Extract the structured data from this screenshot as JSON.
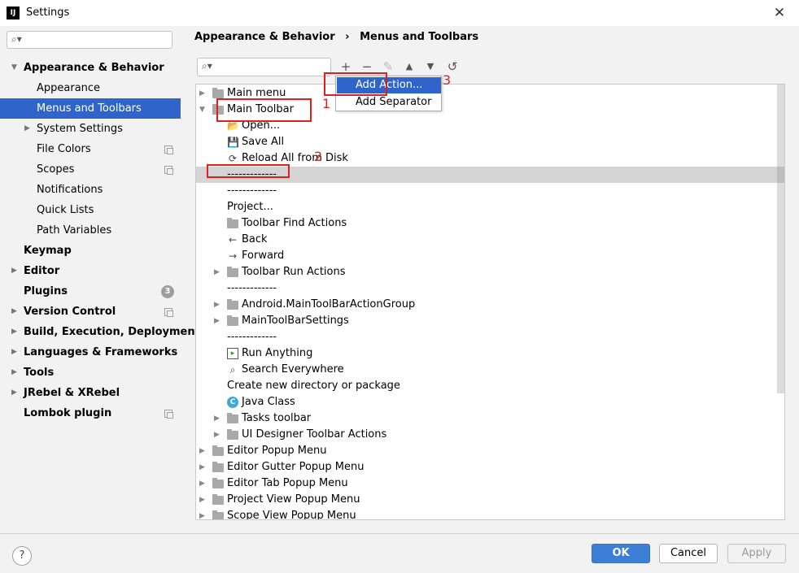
{
  "window": {
    "title": "Settings",
    "app_icon_label": "IJ"
  },
  "sidebar": {
    "search_placeholder": "",
    "items": [
      {
        "label": "Appearance & Behavior",
        "bold": true,
        "arrow": "▼"
      },
      {
        "label": "Appearance"
      },
      {
        "label": "Menus and Toolbars",
        "selected": true
      },
      {
        "label": "System Settings",
        "arrow": "▶"
      },
      {
        "label": "File Colors",
        "copy": true
      },
      {
        "label": "Scopes",
        "copy": true
      },
      {
        "label": "Notifications"
      },
      {
        "label": "Quick Lists"
      },
      {
        "label": "Path Variables"
      },
      {
        "label": "Keymap",
        "bold": true
      },
      {
        "label": "Editor",
        "bold": true,
        "arrow": "▶"
      },
      {
        "label": "Plugins",
        "bold": true,
        "badge": "3"
      },
      {
        "label": "Version Control",
        "bold": true,
        "arrow": "▶",
        "copy": true
      },
      {
        "label": "Build, Execution, Deployment",
        "bold": true,
        "arrow": "▶"
      },
      {
        "label": "Languages & Frameworks",
        "bold": true,
        "arrow": "▶"
      },
      {
        "label": "Tools",
        "bold": true,
        "arrow": "▶"
      },
      {
        "label": "JRebel & XRebel",
        "bold": true,
        "arrow": "▶"
      },
      {
        "label": "Lombok plugin",
        "bold": true,
        "copy": true
      }
    ]
  },
  "breadcrumb": {
    "parent": "Appearance & Behavior",
    "separator": "›",
    "current": "Menus and Toolbars"
  },
  "toolbar": {
    "add_icon": "+",
    "remove_icon": "−",
    "edit_icon": "✎",
    "up_icon": "▲",
    "down_icon": "▼",
    "restore_icon": "↺"
  },
  "tree": {
    "rows": [
      {
        "text": "Main menu",
        "toggle": "▶",
        "icon": "folder",
        "level": 0
      },
      {
        "text": "Main Toolbar",
        "toggle": "▼",
        "icon": "folder",
        "level": 0
      },
      {
        "text": "Open...",
        "icon": "folder-open",
        "level": 1
      },
      {
        "text": "Save All",
        "icon": "save",
        "level": 1
      },
      {
        "text": "Reload All from Disk",
        "icon": "reload",
        "level": 1
      },
      {
        "text": "-------------",
        "level": 1,
        "selected": true
      },
      {
        "text": "-------------",
        "level": 1
      },
      {
        "text": "Project...",
        "level": 1
      },
      {
        "text": "Toolbar Find Actions",
        "icon": "folder",
        "level": 1
      },
      {
        "text": "Back",
        "icon": "arrow-left",
        "level": 1
      },
      {
        "text": "Forward",
        "icon": "arrow-right",
        "level": 1
      },
      {
        "text": "Toolbar Run Actions",
        "toggle": "▶",
        "icon": "folder",
        "level": 1
      },
      {
        "text": "-------------",
        "level": 1
      },
      {
        "text": "Android.MainToolBarActionGroup",
        "toggle": "▶",
        "icon": "folder",
        "level": 1
      },
      {
        "text": "MainToolBarSettings",
        "toggle": "▶",
        "icon": "folder",
        "level": 1
      },
      {
        "text": "-------------",
        "level": 1
      },
      {
        "text": "Run Anything",
        "icon": "run",
        "level": 1
      },
      {
        "text": "Search Everywhere",
        "icon": "search",
        "level": 1
      },
      {
        "text": "Create new directory or package",
        "level": 1
      },
      {
        "text": "Java Class",
        "icon": "java-class",
        "level": 1
      },
      {
        "text": "Tasks toolbar",
        "toggle": "▶",
        "icon": "folder",
        "level": 1
      },
      {
        "text": "UI Designer Toolbar Actions",
        "toggle": "▶",
        "icon": "folder",
        "level": 1
      },
      {
        "text": "Editor Popup Menu",
        "toggle": "▶",
        "icon": "folder",
        "level": 0
      },
      {
        "text": "Editor Gutter Popup Menu",
        "toggle": "▶",
        "icon": "folder",
        "level": 0
      },
      {
        "text": "Editor Tab Popup Menu",
        "toggle": "▶",
        "icon": "folder",
        "level": 0
      },
      {
        "text": "Project View Popup Menu",
        "toggle": "▶",
        "icon": "folder",
        "level": 0
      },
      {
        "text": "Scope View Popup Menu",
        "toggle": "▶",
        "icon": "folder",
        "level": 0
      }
    ]
  },
  "popup": {
    "items": [
      {
        "label": "Add Action...",
        "highlighted": true
      },
      {
        "label": "Add Separator"
      }
    ]
  },
  "annotations": {
    "label_1": "1",
    "label_2": "2",
    "label_3": "3",
    "color": "#e02020"
  },
  "footer": {
    "help": "?",
    "ok": "OK",
    "cancel": "Cancel",
    "apply": "Apply"
  },
  "colors": {
    "selection": "#2f65ca",
    "ok_button": "#3d7fd6"
  }
}
